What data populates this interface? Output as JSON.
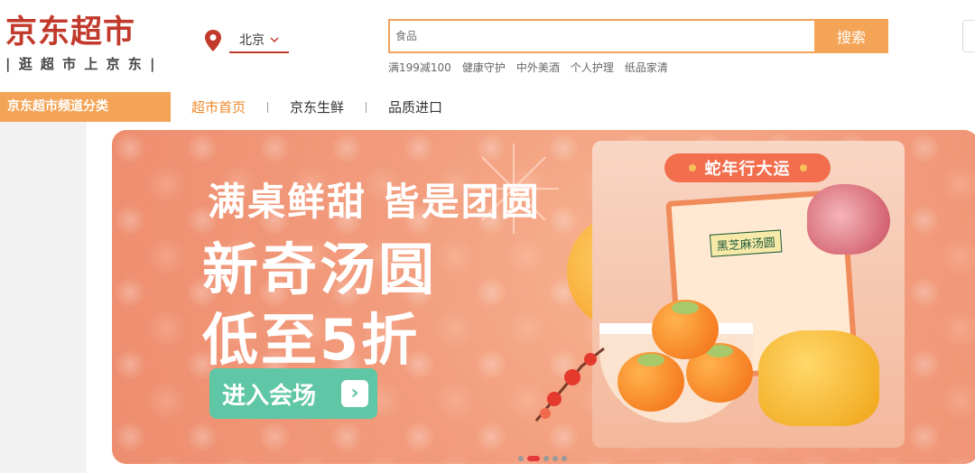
{
  "header": {
    "logo_main": "京东超市",
    "logo_sub": "| 逛 超 市 上 京 东 |",
    "location": {
      "city": "北京"
    },
    "search": {
      "placeholder": "食品",
      "button_label": "搜索"
    },
    "hot_words": [
      "满199减100",
      "健康守护",
      "中外美酒",
      "个人护理",
      "纸品家清"
    ]
  },
  "nav": {
    "category_title": "京东超市频道分类",
    "items": [
      {
        "label": "超市首页",
        "active": true
      },
      {
        "label": "京东生鲜",
        "active": false
      },
      {
        "label": "品质进口",
        "active": false
      }
    ]
  },
  "banner": {
    "headline": "满桌鲜甜 皆是团圆",
    "line1": "新奇汤圆",
    "line2": "低至5折",
    "cta_label": "进入会场",
    "ribbon_text": "蛇年行大运",
    "package_label": "黑芝麻汤圆",
    "carousel": {
      "count": 5,
      "active_index": 1
    },
    "colors": {
      "accent": "#f4a456",
      "cta": "#5fc6a6",
      "brand_red": "#c23a2b"
    }
  }
}
